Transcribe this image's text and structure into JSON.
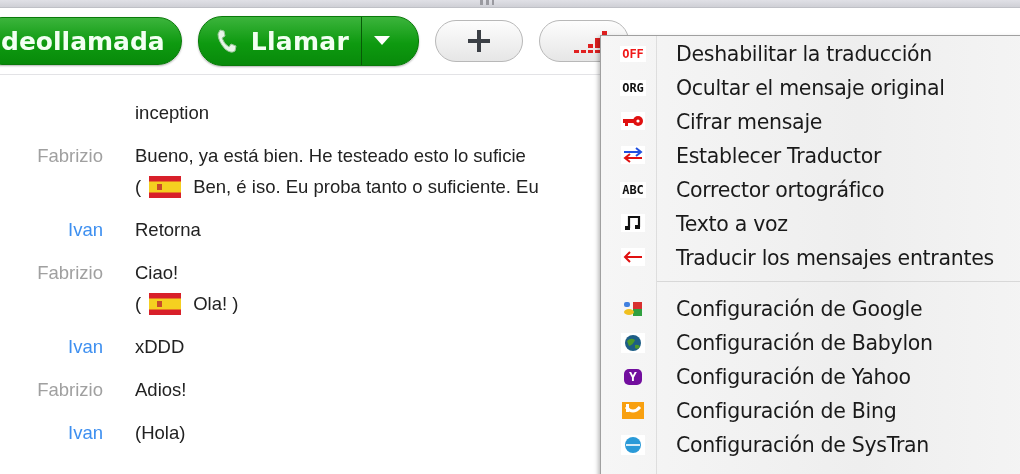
{
  "toolbar": {
    "buttons": [
      {
        "kind": "video",
        "label": "deollamada"
      },
      {
        "kind": "call",
        "label": "Llamar"
      },
      {
        "kind": "add"
      },
      {
        "kind": "signal"
      }
    ]
  },
  "messages": [
    {
      "text": "inception"
    },
    {
      "sender": "Fabrizio",
      "color": "#a0a0a0",
      "text": "Bueno, ya está bien. He testeado esto lo suficie",
      "translation": {
        "open": "(",
        "text": "Ben, é iso. Eu proba tanto o suficiente. Eu"
      }
    },
    {
      "sender": "Ivan",
      "color": "#3d8ff0",
      "text": "Retorna"
    },
    {
      "sender": "Fabrizio",
      "color": "#a0a0a0",
      "text": "Ciao!",
      "translation": {
        "open": "(",
        "text": "Ola! )"
      }
    },
    {
      "sender": "Ivan",
      "color": "#3d8ff0",
      "text": "xDDD"
    },
    {
      "sender": "Fabrizio",
      "color": "#a0a0a0",
      "text": "Adios!"
    },
    {
      "sender": "Ivan",
      "color": "#3d8ff0",
      "text": "(Hola)"
    }
  ],
  "menu": {
    "groups": [
      [
        {
          "label": "Deshabilitar la traducción",
          "badge": "OFF"
        },
        {
          "label": "Ocultar el mensaje original",
          "badge": "ORG"
        },
        {
          "label": "Cifrar mensaje"
        },
        {
          "label": "Establecer Traductor"
        },
        {
          "label": "Corrector ortográfico",
          "badge": "ABC"
        },
        {
          "label": "Texto a voz"
        },
        {
          "label": "Traducir los mensajes entrantes"
        }
      ],
      [
        {
          "label": "Configuración de Google"
        },
        {
          "label": "Configuración de Babylon"
        },
        {
          "label": "Configuración de Yahoo",
          "badge": "Y"
        },
        {
          "label": "Configuración de Bing"
        },
        {
          "label": "Configuración de SysTran"
        }
      ]
    ]
  }
}
